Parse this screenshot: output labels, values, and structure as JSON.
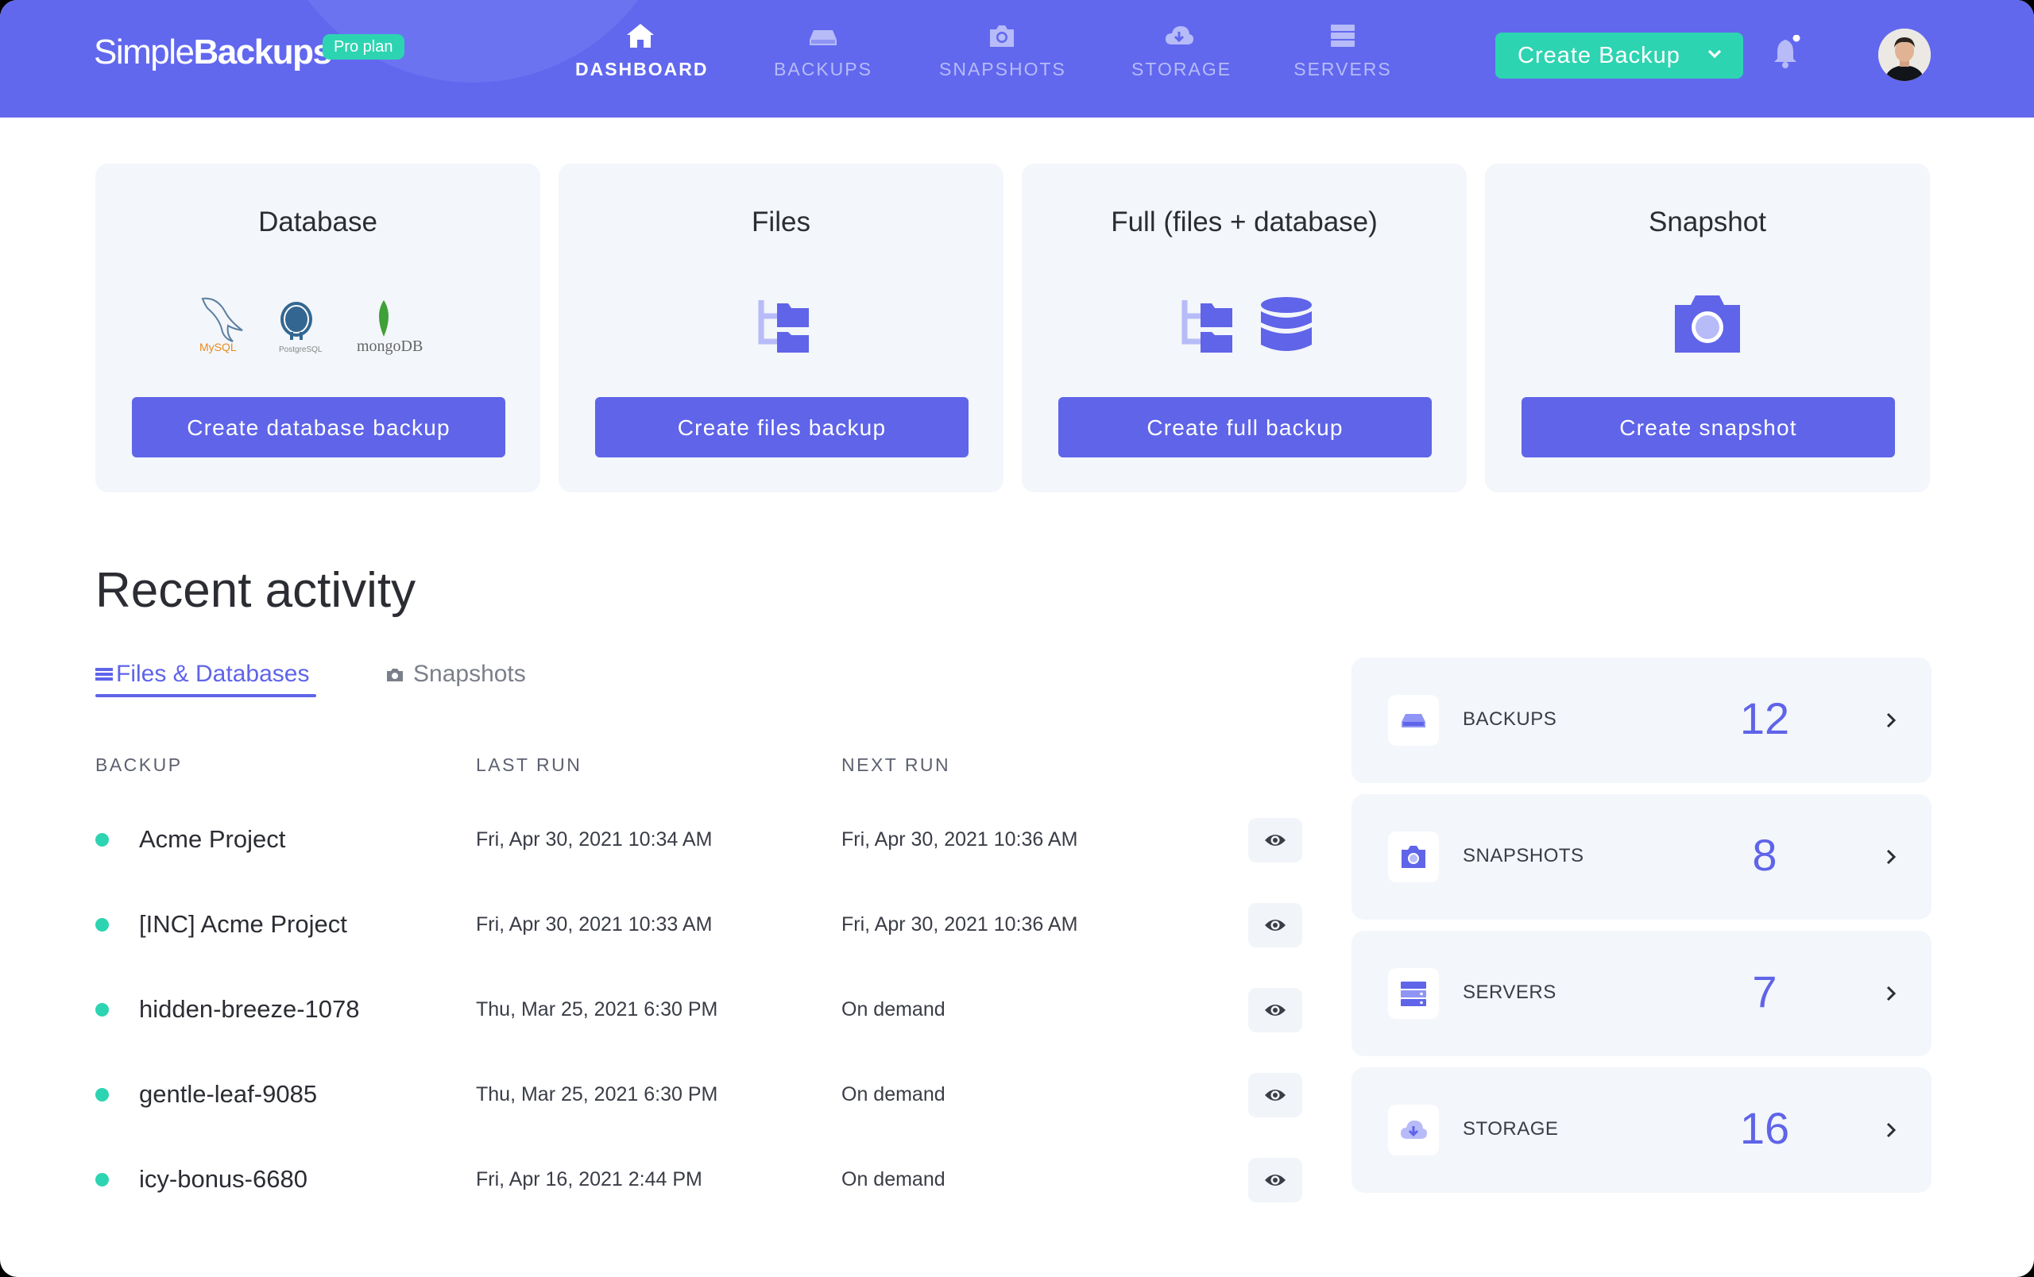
{
  "header": {
    "logo_light": "Simple",
    "logo_bold": "Backups",
    "plan_badge": "Pro plan",
    "nav": [
      {
        "label": "DASHBOARD",
        "icon": "home-icon",
        "active": true
      },
      {
        "label": "BACKUPS",
        "icon": "drive-icon",
        "active": false
      },
      {
        "label": "SNAPSHOTS",
        "icon": "camera-icon",
        "active": false
      },
      {
        "label": "STORAGE",
        "icon": "cloud-download-icon",
        "active": false
      },
      {
        "label": "SERVERS",
        "icon": "server-icon",
        "active": false
      }
    ],
    "cta_label": "Create Backup",
    "notification_icon": "bell-icon",
    "avatar_icon": "user-avatar"
  },
  "cards": [
    {
      "title": "Database",
      "button": "Create database backup",
      "logos": [
        "MySQL",
        "PostgreSQL",
        "mongoDB"
      ]
    },
    {
      "title": "Files",
      "button": "Create files backup"
    },
    {
      "title": "Full (files + database)",
      "button": "Create full backup"
    },
    {
      "title": "Snapshot",
      "button": "Create snapshot"
    }
  ],
  "activity": {
    "title": "Recent activity",
    "tabs": [
      {
        "label": "Files & Databases",
        "icon": "list-icon",
        "active": true
      },
      {
        "label": "Snapshots",
        "icon": "camera-icon",
        "active": false
      }
    ],
    "columns": [
      "BACKUP",
      "LAST RUN",
      "NEXT RUN"
    ],
    "rows": [
      {
        "name": "Acme Project",
        "last_run": "Fri, Apr 30, 2021 10:34 AM",
        "next_run": "Fri, Apr 30, 2021 10:36 AM",
        "status_color": "#2dd4b1"
      },
      {
        "name": "[INC] Acme Project",
        "last_run": "Fri, Apr 30, 2021 10:33 AM",
        "next_run": "Fri, Apr 30, 2021 10:36 AM",
        "status_color": "#2dd4b1"
      },
      {
        "name": "hidden-breeze-1078",
        "last_run": "Thu, Mar 25, 2021 6:30 PM",
        "next_run": "On demand",
        "status_color": "#2dd4b1"
      },
      {
        "name": "gentle-leaf-9085",
        "last_run": "Thu, Mar 25, 2021 6:30 PM",
        "next_run": "On demand",
        "status_color": "#2dd4b1"
      },
      {
        "name": "icy-bonus-6680",
        "last_run": "Fri, Apr 16, 2021 2:44 PM",
        "next_run": "On demand",
        "status_color": "#2dd4b1"
      }
    ]
  },
  "stats": [
    {
      "label": "BACKUPS",
      "value": "12",
      "icon": "drive-icon"
    },
    {
      "label": "SNAPSHOTS",
      "value": "8",
      "icon": "camera-icon"
    },
    {
      "label": "SERVERS",
      "value": "7",
      "icon": "server-icon"
    },
    {
      "label": "STORAGE",
      "value": "16",
      "icon": "cloud-download-icon"
    }
  ],
  "colors": {
    "primary": "#6168ee",
    "button": "#5f64e9",
    "accent": "#2dd4b1",
    "card_bg": "#f3f6fa"
  }
}
